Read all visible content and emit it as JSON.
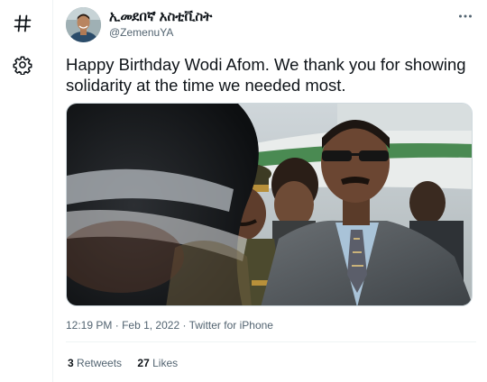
{
  "nav": {
    "icons": [
      "hashtag-icon",
      "gear-icon"
    ]
  },
  "tweet": {
    "author": {
      "display_name": "ኢመደበኛ አስቲቪስት",
      "handle": "@ZemenuYA"
    },
    "text": "Happy Birthday Wodi Afom. We thank you for showing solidarity at the time we needed most.",
    "time": "12:19 PM",
    "date": "Feb 1, 2022",
    "separator": "·",
    "source": "Twitter for iPhone",
    "retweets_count": "3",
    "retweets_label": "Retweets",
    "likes_count": "27",
    "likes_label": "Likes"
  },
  "colors": {
    "text_primary": "#0f1419",
    "text_secondary": "#536471",
    "border": "#eff3f4"
  }
}
